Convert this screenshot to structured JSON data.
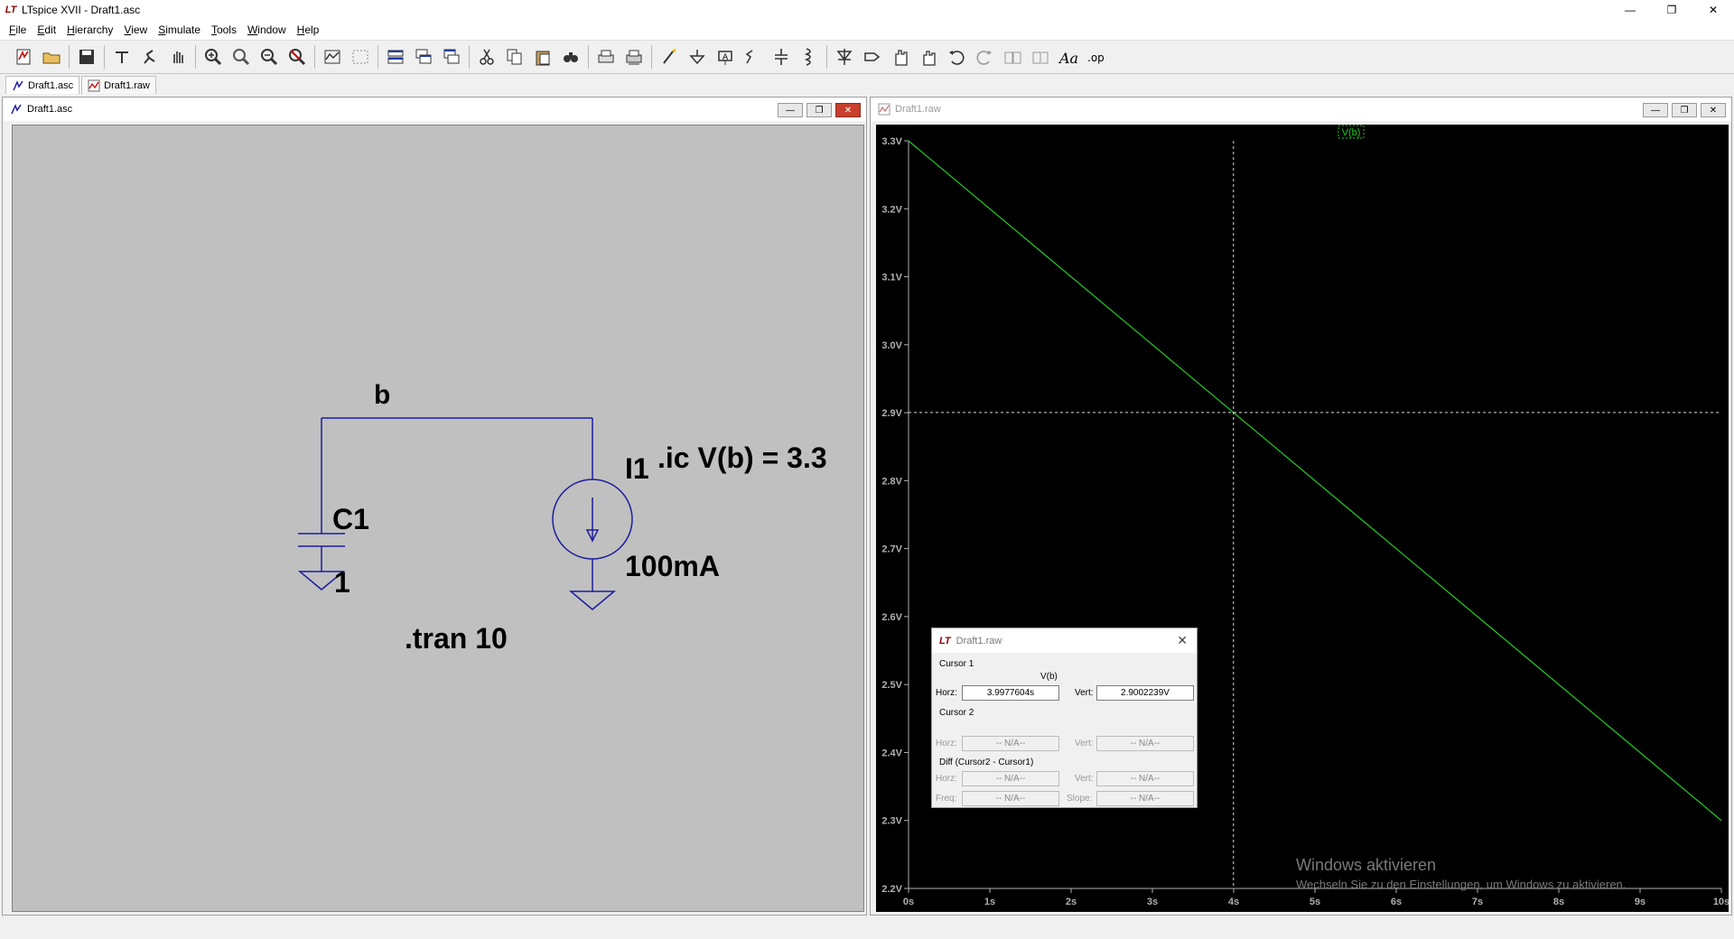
{
  "window": {
    "title": "LTspice XVII - Draft1.asc",
    "app_icon": "LT",
    "minimize": "—",
    "restore": "❐",
    "close": "✕"
  },
  "menu": [
    {
      "key": "F",
      "rest": "ile"
    },
    {
      "key": "E",
      "rest": "dit"
    },
    {
      "key": "H",
      "rest": "ierarchy"
    },
    {
      "key": "V",
      "rest": "iew"
    },
    {
      "key": "S",
      "rest": "imulate"
    },
    {
      "key": "T",
      "rest": "ools"
    },
    {
      "key": "W",
      "rest": "indow"
    },
    {
      "key": "H",
      "rest": "elp"
    }
  ],
  "toolbar_icons": [
    "new-schematic-icon",
    "open-icon",
    "sep",
    "save-icon",
    "sep",
    "control-panel-icon",
    "run-icon",
    "pan-hand-icon",
    "sep",
    "zoom-in-icon",
    "zoom-area-icon",
    "zoom-out-icon",
    "zoom-fit-icon",
    "sep",
    "autorange-icon",
    "mark-unref-icon",
    "sep",
    "tile-horizontal-icon",
    "cascade-icon",
    "tile-vertical-icon",
    "sep",
    "cut-icon",
    "copy-icon",
    "paste-icon",
    "find-icon",
    "sep",
    "print-icon",
    "print-setup-icon",
    "sep",
    "wire-icon",
    "ground-icon",
    "label-net-icon",
    "resistor-icon",
    "capacitor-icon",
    "inductor-icon",
    "sep",
    "diode-icon",
    "component-icon",
    "move-icon",
    "drag-icon",
    "undo-icon",
    "redo-icon",
    "rotate-icon",
    "mirror-icon",
    "text-icon",
    "spice-directive-icon"
  ],
  "tabs": [
    {
      "label": "Draft1.asc",
      "icon": "schematic-icon"
    },
    {
      "label": "Draft1.raw",
      "icon": "waveform-icon"
    }
  ],
  "schematic": {
    "title": "Draft1.asc",
    "net_label": "b",
    "cap_name": "C1",
    "cap_value": "1",
    "src_name": "I1",
    "src_value": "100mA",
    "directive_ic": ".ic V(b) = 3.3",
    "directive_tran": ".tran 10",
    "wire_color": "#1c1c9c"
  },
  "waveform": {
    "title": "Draft1.raw",
    "trace_label": "V(b)",
    "trace_color": "#22cc22",
    "axis_color": "#b0b0b0"
  },
  "chart_data": {
    "type": "line",
    "x": [
      0,
      10
    ],
    "series": [
      {
        "name": "V(b)",
        "values": [
          3.3,
          2.3
        ]
      }
    ],
    "xlabel": "",
    "ylabel": "",
    "xlim": [
      0,
      10
    ],
    "ylim": [
      2.2,
      3.3
    ],
    "x_ticks": [
      "0s",
      "1s",
      "2s",
      "3s",
      "4s",
      "5s",
      "6s",
      "7s",
      "8s",
      "9s",
      "10s"
    ],
    "y_ticks": [
      "3.3V",
      "3.2V",
      "3.1V",
      "3.0V",
      "2.9V",
      "2.8V",
      "2.7V",
      "2.6V",
      "2.5V",
      "2.4V",
      "2.3V",
      "2.2V"
    ],
    "cursor": {
      "x": 3.9977604,
      "y": 2.9002239
    },
    "grid": false
  },
  "cursor_dialog": {
    "title": "Draft1.raw",
    "cursor1_label": "Cursor 1",
    "trace": "V(b)",
    "horz_label": "Horz:",
    "vert_label": "Vert:",
    "c1_horz": "3.9977604s",
    "c1_vert": "2.9002239V",
    "cursor2_label": "Cursor 2",
    "c2_horz": "-- N/A--",
    "c2_vert": "-- N/A--",
    "diff_label": "Diff (Cursor2 - Cursor1)",
    "d_horz": "-- N/A--",
    "d_vert": "-- N/A--",
    "freq_label": "Freq:",
    "slope_label": "Slope:",
    "d_freq": "-- N/A--",
    "d_slope": "-- N/A--"
  },
  "watermark": {
    "line1": "Windows aktivieren",
    "line2": "Wechseln Sie zu den Einstellungen, um Windows zu aktivieren."
  }
}
